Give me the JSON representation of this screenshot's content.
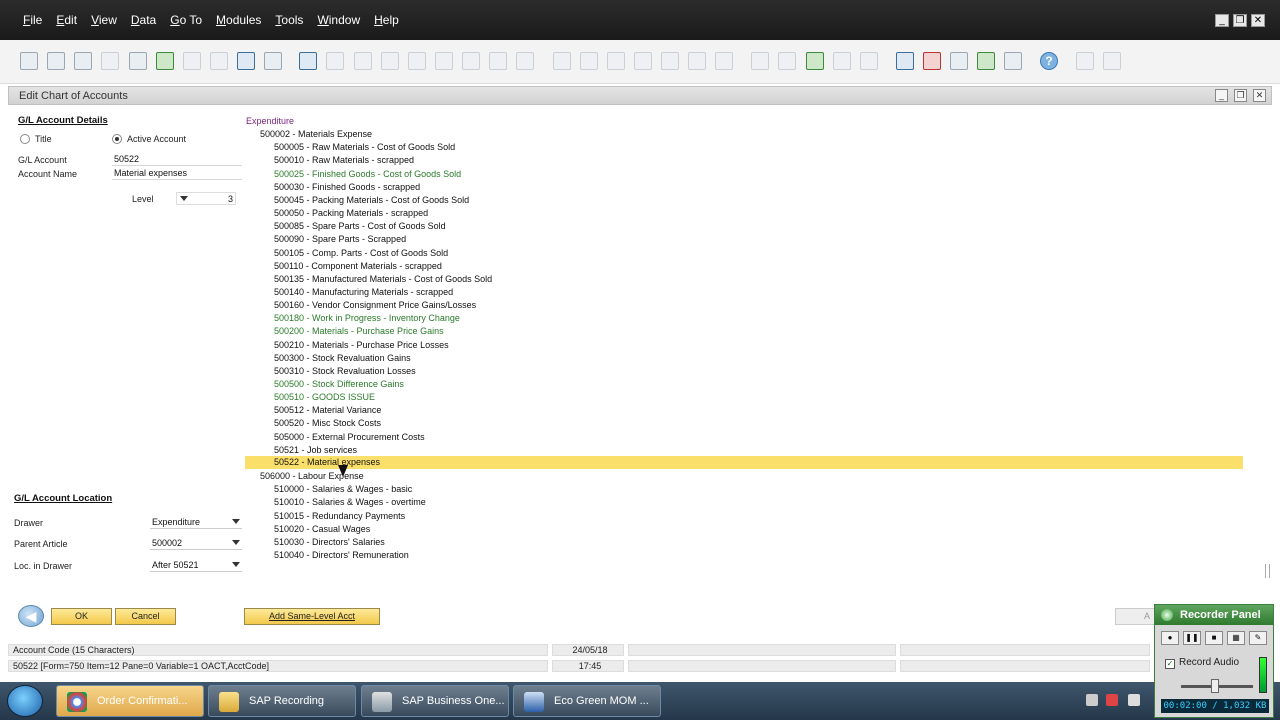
{
  "menu": [
    "File",
    "Edit",
    "View",
    "Data",
    "Go To",
    "Modules",
    "Tools",
    "Window",
    "Help"
  ],
  "app_controls": [
    "_",
    "❐",
    "✕"
  ],
  "window": {
    "title": "Edit Chart of Accounts",
    "controls": [
      "_",
      "❐",
      "✕"
    ]
  },
  "gl_details": {
    "heading": "G/L Account Details",
    "radio_title": "Title",
    "radio_active": "Active Account",
    "account_label": "G/L Account",
    "account_value": "50522",
    "name_label": "Account Name",
    "name_value": "Material expenses",
    "level_label": "Level",
    "level_value": "3"
  },
  "gl_location": {
    "heading": "G/L Account Location",
    "drawer_label": "Drawer",
    "drawer_value": "Expenditure",
    "parent_label": "Parent Article",
    "parent_value": "500002",
    "loc_label": "Loc. in Drawer",
    "loc_value": "After 50521"
  },
  "tree": [
    {
      "text": "Expenditure",
      "indent": 0,
      "color": "purple"
    },
    {
      "text": "500002 - Materials Expense",
      "indent": 1,
      "color": "black"
    },
    {
      "text": "500005 - Raw Materials - Cost of Goods Sold",
      "indent": 2,
      "color": "black"
    },
    {
      "text": "500010 - Raw Materials - scrapped",
      "indent": 2,
      "color": "black"
    },
    {
      "text": "500025 - Finished Goods - Cost of Goods Sold",
      "indent": 2,
      "color": "green"
    },
    {
      "text": "500030 - Finished Goods - scrapped",
      "indent": 2,
      "color": "black"
    },
    {
      "text": "500045 - Packing Materials - Cost of Goods Sold",
      "indent": 2,
      "color": "black"
    },
    {
      "text": "500050 - Packing Materials - scrapped",
      "indent": 2,
      "color": "black"
    },
    {
      "text": "500085 - Spare Parts - Cost of Goods Sold",
      "indent": 2,
      "color": "black"
    },
    {
      "text": "500090 - Spare Parts - Scrapped",
      "indent": 2,
      "color": "black"
    },
    {
      "text": "500105 - Comp.  Parts - Cost of Goods Sold",
      "indent": 2,
      "color": "black"
    },
    {
      "text": "500110 - Component Materials - scrapped",
      "indent": 2,
      "color": "black"
    },
    {
      "text": "500135 - Manufactured Materials - Cost of Goods Sold",
      "indent": 2,
      "color": "black"
    },
    {
      "text": "500140 - Manufacturing Materials - scrapped",
      "indent": 2,
      "color": "black"
    },
    {
      "text": "500160 - Vendor Consignment Price Gains/Losses",
      "indent": 2,
      "color": "black"
    },
    {
      "text": "500180 - Work in Progress - Inventory Change",
      "indent": 2,
      "color": "green"
    },
    {
      "text": "500200 - Materials - Purchase Price Gains",
      "indent": 2,
      "color": "green"
    },
    {
      "text": "500210 - Materials - Purchase Price Losses",
      "indent": 2,
      "color": "black"
    },
    {
      "text": "500300 - Stock Revaluation Gains",
      "indent": 2,
      "color": "black"
    },
    {
      "text": "500310 - Stock Revaluation Losses",
      "indent": 2,
      "color": "black"
    },
    {
      "text": "500500 - Stock Difference Gains",
      "indent": 2,
      "color": "green"
    },
    {
      "text": "500510 - GOODS ISSUE",
      "indent": 2,
      "color": "green"
    },
    {
      "text": "500512 - Material Variance",
      "indent": 2,
      "color": "black"
    },
    {
      "text": "500520 - Misc Stock Costs",
      "indent": 2,
      "color": "black"
    },
    {
      "text": "505000 - External Procurement Costs",
      "indent": 2,
      "color": "black"
    },
    {
      "text": "50521 - Job services",
      "indent": 2,
      "color": "black"
    },
    {
      "text": "50522 - Material expenses",
      "indent": 2,
      "color": "black",
      "selected": true
    },
    {
      "text": "506000 - Labour Expense",
      "indent": 1,
      "color": "black"
    },
    {
      "text": "510000 - Salaries & Wages - basic",
      "indent": 2,
      "color": "black"
    },
    {
      "text": "510010 - Salaries & Wages - overtime",
      "indent": 2,
      "color": "black"
    },
    {
      "text": "510015 - Redundancy Payments",
      "indent": 2,
      "color": "black"
    },
    {
      "text": "510020 - Casual Wages",
      "indent": 2,
      "color": "black"
    },
    {
      "text": "510030 - Directors' Salaries",
      "indent": 2,
      "color": "black"
    },
    {
      "text": "510040 - Directors' Remuneration",
      "indent": 2,
      "color": "black"
    }
  ],
  "buttons": {
    "ok": "OK",
    "cancel": "Cancel",
    "add_same_level": "Add Same-Level Acct",
    "right_partial": "A"
  },
  "status": {
    "row1_text": "Account Code (15 Characters)",
    "row1_date": "24/05/18",
    "row2_text": "50522 [Form=750 Item=12 Pane=0 Variable=1 OACT,AcctCode]",
    "row2_time": "17:45"
  },
  "taskbar": [
    {
      "label": "Order Confirmati...",
      "icon": "chrome-icon",
      "active": true
    },
    {
      "label": "SAP Recording",
      "icon": "folder-icon",
      "active": false
    },
    {
      "label": "SAP Business One...",
      "icon": "sap-icon",
      "active": false
    },
    {
      "label": "Eco Green MOM ...",
      "icon": "word-icon",
      "active": false
    }
  ],
  "recorder": {
    "title": "Recorder Panel",
    "record_audio": "Record Audio",
    "time": "00:02:00 / 1,032 KB"
  },
  "colors": {
    "highlight": "#fbdf6b",
    "green_text": "#2a7a2a",
    "purple_text": "#7a1f7a",
    "button_yellow": "#f4c94a"
  }
}
